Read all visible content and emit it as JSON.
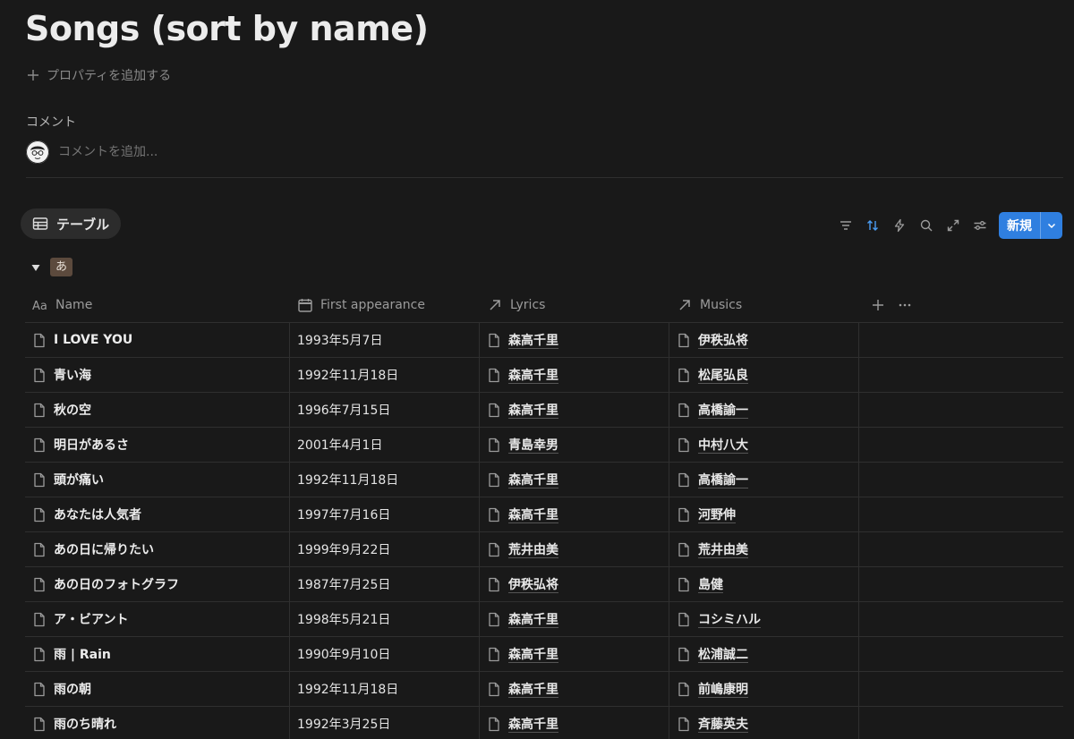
{
  "page": {
    "title": "Songs (sort by name)",
    "add_property": "プロパティを追加する",
    "comments_label": "コメント",
    "comment_placeholder": "コメントを追加..."
  },
  "view": {
    "tab_label": "テーブル",
    "new_button": "新規",
    "accent": "#2f7fe0"
  },
  "group": {
    "label": "あ",
    "color": "#5c4a3d"
  },
  "columns": {
    "name": "Name",
    "first_appearance": "First appearance",
    "lyrics": "Lyrics",
    "musics": "Musics"
  },
  "rows": [
    {
      "name": "I LOVE YOU",
      "date": "1993年5月7日",
      "lyrics": "森高千里",
      "musics": "伊秩弘将"
    },
    {
      "name": "青い海",
      "date": "1992年11月18日",
      "lyrics": "森高千里",
      "musics": "松尾弘良"
    },
    {
      "name": "秋の空",
      "date": "1996年7月15日",
      "lyrics": "森高千里",
      "musics": "高橋諭一"
    },
    {
      "name": "明日があるさ",
      "date": "2001年4月1日",
      "lyrics": "青島幸男",
      "musics": "中村八大"
    },
    {
      "name": "頭が痛い",
      "date": "1992年11月18日",
      "lyrics": "森高千里",
      "musics": "高橋諭一"
    },
    {
      "name": "あなたは人気者",
      "date": "1997年7月16日",
      "lyrics": "森高千里",
      "musics": "河野伸"
    },
    {
      "name": "あの日に帰りたい",
      "date": "1999年9月22日",
      "lyrics": "荒井由美",
      "musics": "荒井由美"
    },
    {
      "name": "あの日のフォトグラフ",
      "date": "1987年7月25日",
      "lyrics": "伊秩弘将",
      "musics": "島健"
    },
    {
      "name": "ア・ビアント",
      "date": "1998年5月21日",
      "lyrics": "森高千里",
      "musics": "コシミハル"
    },
    {
      "name": "雨 | Rain",
      "date": "1990年9月10日",
      "lyrics": "森高千里",
      "musics": "松浦誠二"
    },
    {
      "name": "雨の朝",
      "date": "1992年11月18日",
      "lyrics": "森高千里",
      "musics": "前嶋康明"
    },
    {
      "name": "雨のち晴れ",
      "date": "1992年3月25日",
      "lyrics": "森高千里",
      "musics": "斉藤英夫"
    }
  ]
}
